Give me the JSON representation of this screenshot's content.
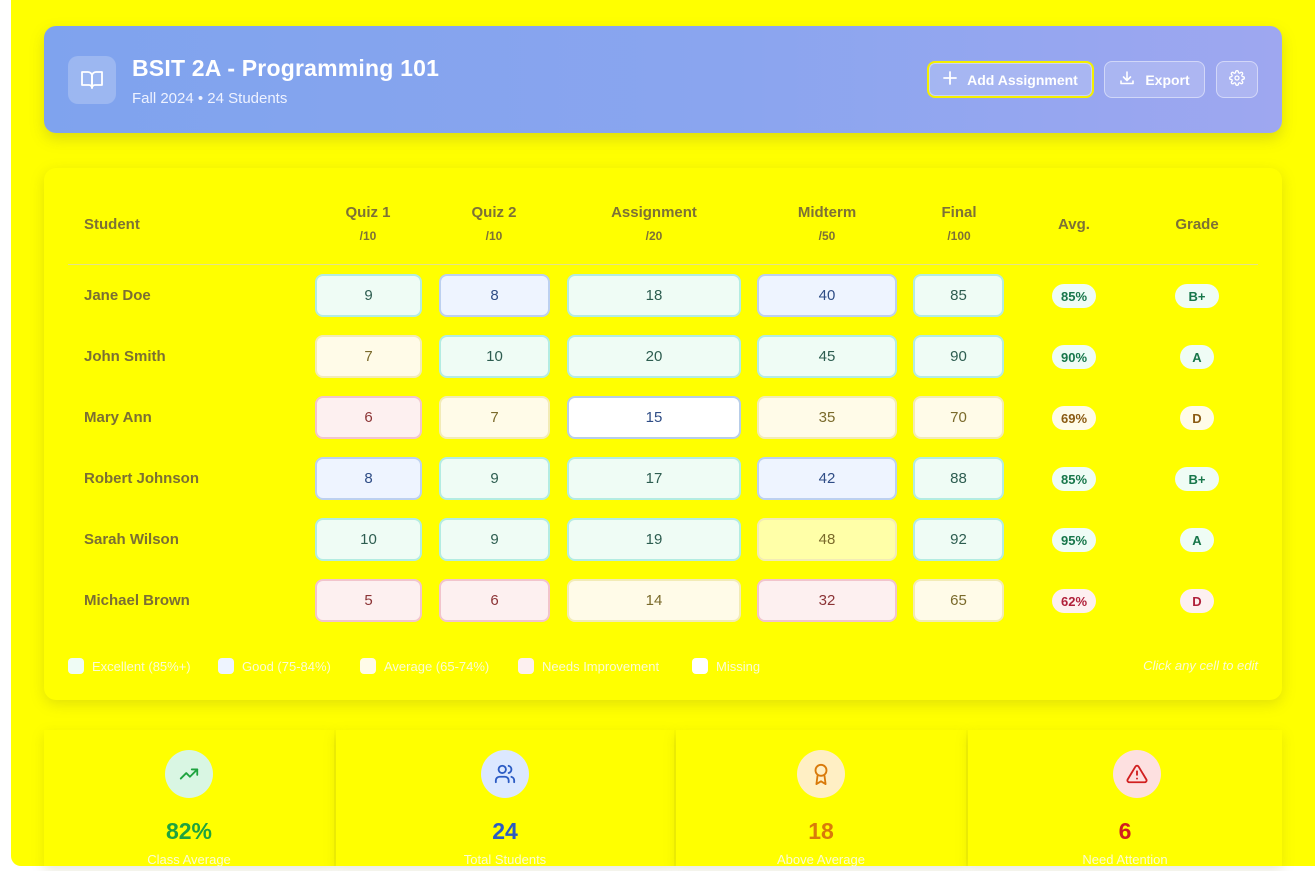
{
  "header": {
    "title": "BSIT 2A - Programming 101",
    "subtitle": "Fall 2024 • 24 Students",
    "add_label": "Add Assignment",
    "export_label": "Export",
    "icon": "open-book-icon"
  },
  "columns": {
    "student": "Student",
    "quiz1": "Quiz 1",
    "quiz1_max": "/10",
    "quiz2": "Quiz 2",
    "quiz2_max": "/10",
    "assignment": "Assignment",
    "assignment_max": "/20",
    "midterm": "Midterm",
    "midterm_max": "/50",
    "final": "Final",
    "final_max": "/100",
    "avg": "Avg.",
    "grade": "Grade"
  },
  "rows": [
    {
      "name": "Jane Doe",
      "quiz1": "9",
      "quiz2": "8",
      "assignment": "18",
      "midterm": "40",
      "final": "85",
      "avg": "85%",
      "grade": "B+"
    },
    {
      "name": "John Smith",
      "quiz1": "7",
      "quiz2": "10",
      "assignment": "20",
      "midterm": "45",
      "final": "90",
      "avg": "90%",
      "grade": "A"
    },
    {
      "name": "Mary Ann",
      "quiz1": "6",
      "quiz2": "7",
      "assignment": "15",
      "midterm": "35",
      "final": "70",
      "avg": "69%",
      "grade": "D"
    },
    {
      "name": "Robert Johnson",
      "quiz1": "8",
      "quiz2": "9",
      "assignment": "17",
      "midterm": "42",
      "final": "88",
      "avg": "85%",
      "grade": "B+"
    },
    {
      "name": "Sarah Wilson",
      "quiz1": "10",
      "quiz2": "9",
      "assignment": "19",
      "midterm": "48",
      "final": "92",
      "avg": "95%",
      "grade": "A"
    },
    {
      "name": "Michael Brown",
      "quiz1": "5",
      "quiz2": "6",
      "assignment": "14",
      "midterm": "32",
      "final": "65",
      "avg": "62%",
      "grade": "D"
    }
  ],
  "legend": {
    "excellent": "Excellent (85%+)",
    "good": "Good (75-84%)",
    "average": "Average (65-74%)",
    "needs": "Needs Improvement",
    "missing": "Missing",
    "note": "Click any cell to edit"
  },
  "stats": [
    {
      "value": "82%",
      "label": "Class Average",
      "icon": "trending-up-icon",
      "color": "#1fa33f"
    },
    {
      "value": "24",
      "label": "Total Students",
      "icon": "users-icon",
      "color": "#2b5bc4"
    },
    {
      "value": "18",
      "label": "Above Average",
      "icon": "award-icon",
      "color": "#d97a0a"
    },
    {
      "value": "6",
      "label": "Need Attention",
      "icon": "alert-triangle-icon",
      "color": "#d11f1f"
    }
  ],
  "colors": {
    "background": "#ffff00",
    "header_gradient_start": "#7fa3ee",
    "header_gradient_end": "#9ea7f0",
    "excellent": "#effcf5",
    "good": "#eef4ff",
    "average": "#fffbe8",
    "needs_improvement": "#fdf0f0",
    "missing": "#ffffff"
  }
}
